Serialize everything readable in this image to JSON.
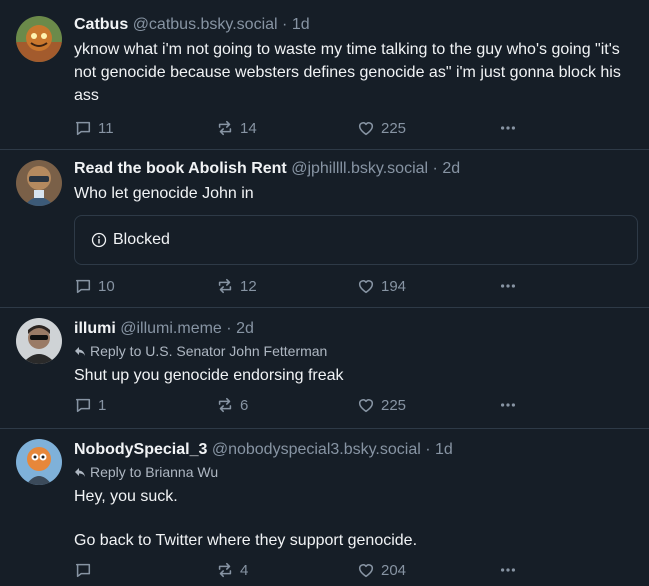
{
  "posts": [
    {
      "author": "Catbus",
      "handle": "@catbus.bsky.social",
      "sep": "·",
      "time": "1d",
      "reply_to": "",
      "lines": [
        "yknow what i'm not going to waste my time talking to the guy who's going \"it's not genocide because websters defines genocide as\" i'm just gonna block his ass"
      ],
      "blocked": "",
      "replies": "11",
      "reposts": "14",
      "likes": "225"
    },
    {
      "author": "Read the book Abolish Rent",
      "handle": "@jphillll.bsky.social",
      "sep": "·",
      "time": "2d",
      "reply_to": "",
      "lines": [
        "Who let genocide John in"
      ],
      "blocked": "Blocked",
      "replies": "10",
      "reposts": "12",
      "likes": "194"
    },
    {
      "author": "illumi",
      "handle": "@illumi.meme",
      "sep": "·",
      "time": "2d",
      "reply_to": "Reply to U.S. Senator John Fetterman",
      "lines": [
        "Shut up you genocide endorsing freak"
      ],
      "blocked": "",
      "replies": "1",
      "reposts": "6",
      "likes": "225"
    },
    {
      "author": "NobodySpecial_3",
      "handle": "@nobodyspecial3.bsky.social",
      "sep": "·",
      "time": "1d",
      "reply_to": "Reply to Brianna Wu",
      "lines": [
        "Hey, you suck.",
        "Go back to Twitter where they support genocide."
      ],
      "blocked": "",
      "replies": "",
      "reposts": "4",
      "likes": "204"
    }
  ],
  "colors": {
    "background": "#161e27",
    "border": "#2e3a47",
    "muted": "#8794a3"
  }
}
